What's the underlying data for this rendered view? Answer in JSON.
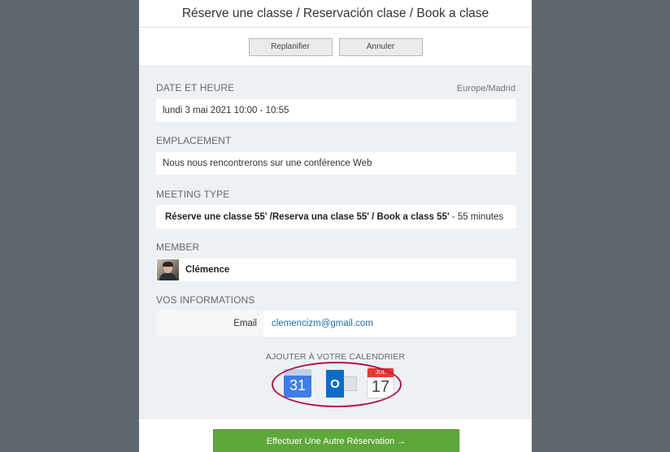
{
  "header": {
    "title": "Réserve une classe / Reservación clase / Book a clase"
  },
  "actions": {
    "reschedule_label": "Replanifier",
    "cancel_label": "Annuler"
  },
  "date_time": {
    "label": "DATE ET HEURE",
    "timezone": "Europe/Madrid",
    "value": "lundi 3 mai 2021 10:00 - 10:55"
  },
  "location": {
    "label": "EMPLACEMENT",
    "value": "Nous nous rencontrerons sur une conférence Web"
  },
  "meeting_type": {
    "label": "MEETING TYPE",
    "name": "Réserve une classe 55' /Reserva una clase 55' / Book a class 55'",
    "duration": " - 55 minutes"
  },
  "member": {
    "label": "MEMBER",
    "name": "Clémence"
  },
  "your_info": {
    "label": "VOS INFORMATIONS",
    "email_label": "Email",
    "email_value": "clemencizm@gmail.com"
  },
  "calendar": {
    "label": "AJOUTER À VOTRE CALENDRIER",
    "google_day": "31",
    "outlook_letter": "O",
    "apple_month": "JUL",
    "apple_day": "17",
    "highlight_color": "#b0134a"
  },
  "footer": {
    "new_booking_label": "Effectuer Une Autre Réservation →"
  }
}
